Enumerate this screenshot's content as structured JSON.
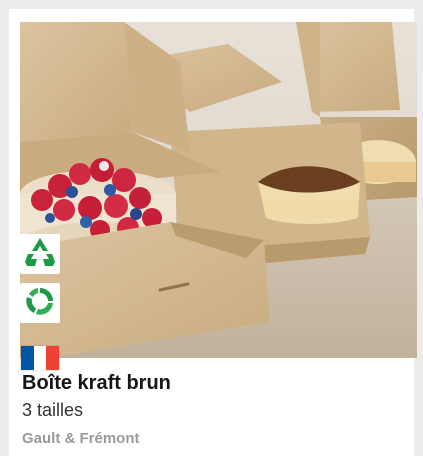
{
  "product": {
    "title": "Boîte kraft brun",
    "subtitle": "3 tailles",
    "brand": "Gault & Frémont"
  },
  "badges": [
    {
      "icon": "recycle-icon"
    },
    {
      "icon": "compostable-icon"
    },
    {
      "icon": "france-flag-icon"
    }
  ],
  "colors": {
    "badge_green": "#1d9a45",
    "flag_blue": "#0055a4",
    "flag_white": "#ffffff",
    "flag_red": "#ef4135"
  }
}
